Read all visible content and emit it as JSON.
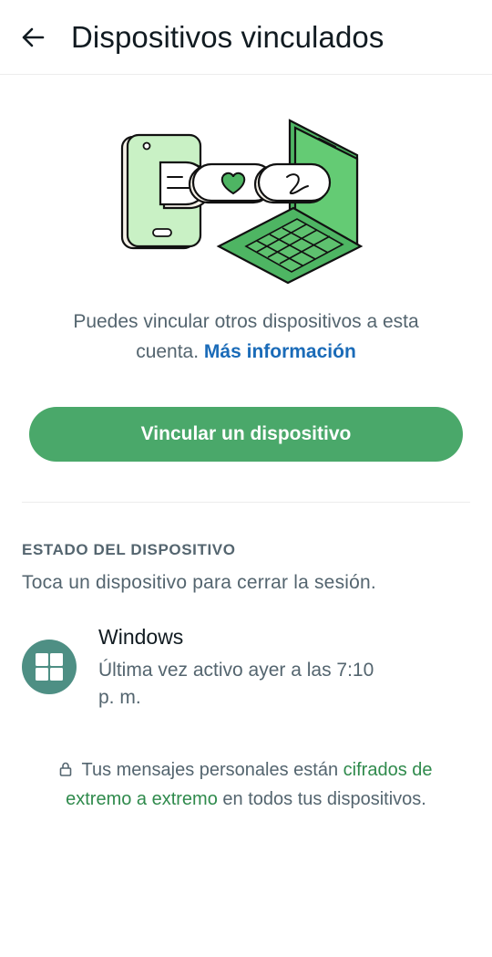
{
  "header": {
    "title": "Dispositivos vinculados"
  },
  "intro": {
    "text": "Puedes vincular otros dispositivos a esta cuenta.",
    "link": "Más información"
  },
  "primary_button": {
    "label": "Vincular un dispositivo"
  },
  "device_status": {
    "header": "ESTADO DEL DISPOSITIVO",
    "subtitle": "Toca un dispositivo para cerrar la sesión.",
    "devices": [
      {
        "name": "Windows",
        "status": "Última vez activo ayer a las 7:10 p. m.",
        "icon": "windows-icon"
      }
    ]
  },
  "footer": {
    "prefix": "Tus mensajes personales están",
    "link": "cifrados de extremo a extremo",
    "suffix": "en todos tus dispositivos."
  },
  "colors": {
    "accent": "#4aa86a",
    "link": "#1a6bb8",
    "device_icon_bg": "#4e8f84",
    "encryption_link": "#2f8a4c"
  }
}
